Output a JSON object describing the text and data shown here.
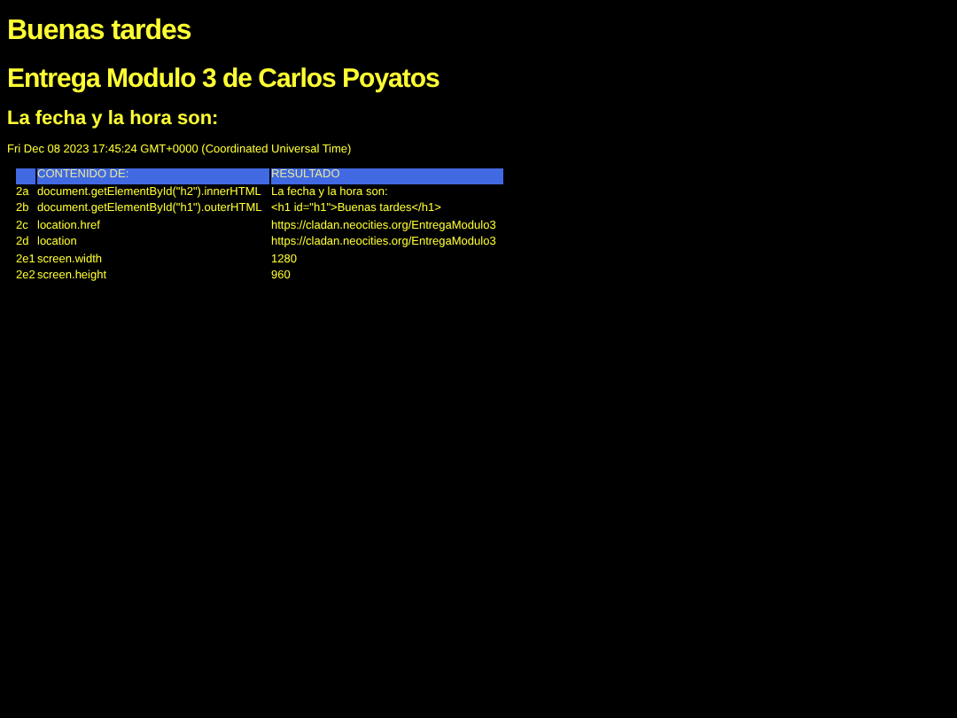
{
  "greeting": "Buenas tardes",
  "title": "Entrega Modulo 3 de Carlos Poyatos",
  "subtitle": "La fecha y la hora son:",
  "date": "Fri Dec 08 2023 17:45:24 GMT+0000 (Coordinated Universal Time)",
  "table": {
    "columns": [
      "CONTENIDO DE:",
      "RESULTADO"
    ],
    "rows": [
      {
        "id": "2a",
        "content": "document.getElementById(\"h2\").innerHTML",
        "result": "La fecha y la hora son:"
      },
      {
        "id": "2b",
        "content": "document.getElementById(\"h1\").outerHTML",
        "result": "<h1 id=\"h1\">Buenas tardes</h1>"
      },
      {
        "id": "2c",
        "content": "location.href",
        "result": "https://cladan.neocities.org/EntregaModulo3"
      },
      {
        "id": "2d",
        "content": "location",
        "result": "https://cladan.neocities.org/EntregaModulo3"
      },
      {
        "id": "2e1",
        "content": "screen.width",
        "result": "1280"
      },
      {
        "id": "2e2",
        "content": "screen.height",
        "result": "960"
      }
    ]
  }
}
